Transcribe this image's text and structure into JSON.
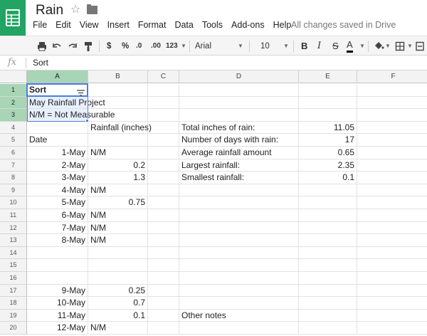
{
  "app": {
    "title": "Rain",
    "save_status": "All changes saved in Drive",
    "accent": "#21a464"
  },
  "menu": [
    "File",
    "Edit",
    "View",
    "Insert",
    "Format",
    "Data",
    "Tools",
    "Add-ons",
    "Help"
  ],
  "toolbar": {
    "currency": "$",
    "percent": "%",
    "decrease_decimal": ".0",
    "increase_decimal": ".00",
    "more_formats": "123",
    "font": "Arial",
    "font_size": "10",
    "bold": "B",
    "italic": "I",
    "strikethrough": "S",
    "text_color_label": "A"
  },
  "formula_bar": {
    "fx": "fx",
    "value": "Sort"
  },
  "sheet": {
    "columns": [
      "A",
      "B",
      "C",
      "D",
      "E",
      "F"
    ],
    "rows": [
      "1",
      "2",
      "3",
      "4",
      "5",
      "6",
      "7",
      "8",
      "9",
      "10",
      "11",
      "12",
      "13",
      "14",
      "15",
      "16",
      "17",
      "18",
      "19",
      "20"
    ],
    "cells": {
      "A1": "Sort",
      "A2": "May Rainfall Project",
      "A3": "N/M = Not Measurable",
      "B4": "Rainfall (inches)",
      "A5": "Date",
      "A6": "1-May",
      "B6": "N/M",
      "A7": "2-May",
      "B7": "0.2",
      "A8": "3-May",
      "B8": "1.3",
      "A9": "4-May",
      "B9": "N/M",
      "A10": "5-May",
      "B10": "0.75",
      "A11": "6-May",
      "B11": "N/M",
      "A12": "7-May",
      "B12": "N/M",
      "A13": "8-May",
      "B13": "N/M",
      "A17": "9-May",
      "B17": "0.25",
      "A18": "10-May",
      "B18": "0.7",
      "A19": "11-May",
      "B19": "0.1",
      "A20": "12-May",
      "B20": "N/M",
      "D4": "Total inches of rain:",
      "E4": "11.05",
      "D5": "Number of days with rain:",
      "E5": "17",
      "D6": "Average rainfall amount",
      "E6": "0.65",
      "D7": "Largest rainfall:",
      "E7": "2.35",
      "D8": "Smallest rainfall:",
      "E8": "0.1",
      "D19": "Other notes"
    }
  }
}
